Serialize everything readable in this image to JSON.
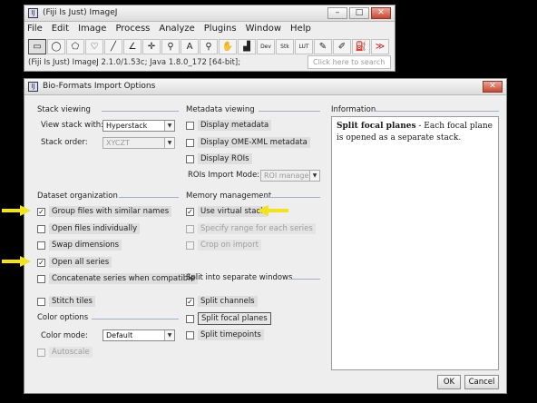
{
  "fiji": {
    "title": "(Fiji Is Just) ImageJ",
    "menu": [
      "File",
      "Edit",
      "Image",
      "Process",
      "Analyze",
      "Plugins",
      "Window",
      "Help"
    ],
    "tools": [
      {
        "name": "rectangle-tool",
        "glyph": "▭",
        "selected": true
      },
      {
        "name": "oval-tool",
        "glyph": "◯"
      },
      {
        "name": "polygon-tool",
        "glyph": "⬠"
      },
      {
        "name": "freehand-tool",
        "glyph": "♡"
      },
      {
        "name": "line-tool",
        "glyph": "╱"
      },
      {
        "name": "angle-tool",
        "glyph": "∠"
      },
      {
        "name": "point-tool",
        "glyph": "✛"
      },
      {
        "name": "wand-tool",
        "glyph": "⚲"
      },
      {
        "name": "text-tool",
        "glyph": "A"
      },
      {
        "name": "magnifier-tool",
        "glyph": "⚲"
      },
      {
        "name": "hand-tool",
        "glyph": "✋"
      },
      {
        "name": "color-picker-tool",
        "glyph": "▟"
      },
      {
        "name": "dev-tool",
        "glyph": "Dev"
      },
      {
        "name": "stk-tool",
        "glyph": "Stk"
      },
      {
        "name": "lut-tool",
        "glyph": "LUT"
      },
      {
        "name": "pencil-tool",
        "glyph": "✎"
      },
      {
        "name": "brush-tool",
        "glyph": "✐"
      },
      {
        "name": "flood-fill-tool",
        "glyph": "⛽"
      },
      {
        "name": "more-tools",
        "glyph": "≫",
        "red": true
      }
    ],
    "status": "(Fiji Is Just) ImageJ 2.1.0/1.53c; Java 1.8.0_172 [64-bit];",
    "search_placeholder": "Click here to search"
  },
  "dialog": {
    "title": "Bio-Formats Import Options",
    "stack_viewing": {
      "heading": "Stack viewing",
      "view_with_label": "View stack with:",
      "view_with_value": "Hyperstack",
      "order_label": "Stack order:",
      "order_value": "XYCZT"
    },
    "dataset": {
      "heading": "Dataset organization",
      "items": [
        {
          "label": "Group files with similar names",
          "checked": true
        },
        {
          "label": "Open files individually",
          "checked": false
        },
        {
          "label": "Swap dimensions",
          "checked": false
        },
        {
          "label": "Open all series",
          "checked": true
        },
        {
          "label": "Concatenate series when compatible",
          "checked": false
        },
        {
          "label": "Stitch tiles",
          "checked": false
        }
      ]
    },
    "color_options": {
      "heading": "Color options",
      "mode_label": "Color mode:",
      "mode_value": "Default",
      "autoscale_label": "Autoscale"
    },
    "metadata": {
      "heading": "Metadata viewing",
      "items": [
        {
          "label": "Display metadata",
          "checked": false
        },
        {
          "label": "Display OME-XML metadata",
          "checked": false
        },
        {
          "label": "Display ROIs",
          "checked": false
        }
      ],
      "roi_mode_label": "ROIs Import Mode:",
      "roi_mode_value": "ROI manager"
    },
    "memory": {
      "heading": "Memory management",
      "virtual_stack": "Use virtual stack",
      "specify_range": "Specify range for each series",
      "crop": "Crop on import"
    },
    "split": {
      "heading": "Split into separate windows",
      "channels": "Split channels",
      "focal_planes": "Split focal planes",
      "timepoints": "Split timepoints"
    },
    "information": {
      "heading": "Information",
      "bold": "Split focal planes",
      "text": " - Each focal plane is opened as a separate stack."
    },
    "ok_label": "OK",
    "cancel_label": "Cancel"
  },
  "colors": {
    "annotation_arrow": "#f2e31b",
    "close_button": "#c9472f"
  }
}
